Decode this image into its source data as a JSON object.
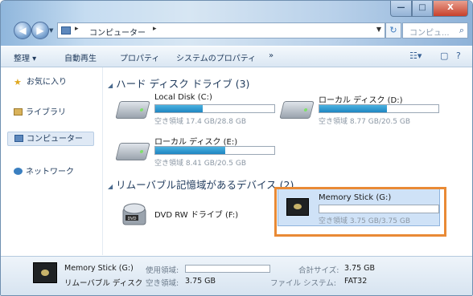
{
  "title_bar": {
    "minimize_glyph": "—",
    "maximize_glyph": "□",
    "close_glyph": "X"
  },
  "address_bar": {
    "path": "コンピューター",
    "search_placeholder": "コンピュ...",
    "back_glyph": "◀",
    "forward_glyph": "▶",
    "refresh_glyph": "↻"
  },
  "toolbar": {
    "organize": "整理 ▾",
    "autoplay": "自動再生",
    "properties": "プロパティ",
    "system_properties": "システムのプロパティ",
    "more": "»"
  },
  "nav": {
    "favorites": "お気に入り",
    "libraries": "ライブラリ",
    "computer": "コンピューター",
    "network": "ネットワーク"
  },
  "groups": {
    "hard_drives": "ハード ディスク ドライブ (3)",
    "removable": "リムーバブル記憶域があるデバイス (2)"
  },
  "drives": [
    {
      "name": "Local Disk (C:)",
      "free": "空き領域 17.4 GB/28.8 GB",
      "used_fraction": 0.4
    },
    {
      "name": "ローカル ディスク (D:)",
      "free": "空き領域 8.77 GB/20.5 GB",
      "used_fraction": 0.57
    },
    {
      "name": "ローカル ディスク (E:)",
      "free": "空き領域 8.41 GB/20.5 GB",
      "used_fraction": 0.59
    }
  ],
  "dvd": {
    "name": "DVD RW ドライブ (F:)",
    "label": "DVD"
  },
  "stick": {
    "name": "Memory Stick (G:)",
    "free": "空き領域 3.75 GB/3.75 GB",
    "used_fraction": 0.0
  },
  "details": {
    "name": "Memory Stick (G:)",
    "type": "リムーバブル ディスク",
    "used_label": "使用領域:",
    "free_label": "空き領域:",
    "free_value": "3.75 GB",
    "total_label": "合計サイズ:",
    "total_value": "3.75 GB",
    "fs_label": "ファイル システム:",
    "fs_value": "FAT32"
  },
  "colors": {
    "highlight": "#e98a35",
    "bar_fill": "#1e86c2",
    "selection": "#cfe2f7"
  }
}
